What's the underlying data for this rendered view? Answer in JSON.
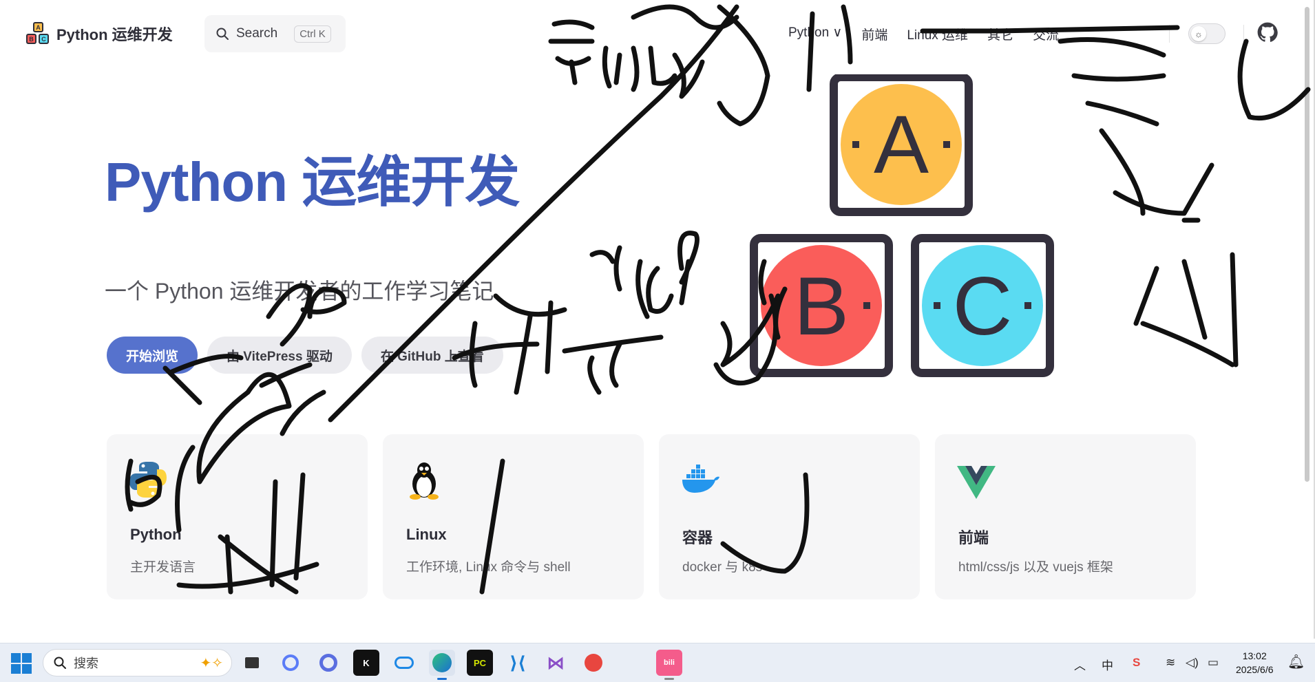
{
  "nav": {
    "site_title": "Python 运维开发",
    "search_placeholder": "Search",
    "search_shortcut": "Ctrl K",
    "links": [
      "Python ∨",
      "前端",
      "Linux 运维",
      "其它",
      "交流"
    ]
  },
  "hero": {
    "name": "Python 运维开发",
    "tagline": "一个 Python 运维开发者的工作学习笔记",
    "actions": [
      "开始浏览",
      "由 VitePress 驱动",
      "在 GitHub 上查看"
    ],
    "image_letters": [
      "A",
      "B",
      "C"
    ]
  },
  "features": [
    {
      "title": "Python",
      "details": "主开发语言",
      "icon": "python-logo-icon"
    },
    {
      "title": "Linux",
      "details": "工作环境, Linux 命令与 shell",
      "icon": "tux-penguin-icon"
    },
    {
      "title": "容器",
      "details": "docker 与 k8s",
      "icon": "docker-whale-icon"
    },
    {
      "title": "前端",
      "details": "html/css/js 以及 vuejs 框架",
      "icon": "vue-logo-icon"
    }
  ],
  "taskbar": {
    "search_placeholder": "搜索",
    "ime": "中",
    "time": "13:02",
    "date": "2025/6/6"
  },
  "colors": {
    "brand": "#5672cd",
    "hero_name": "#3f5bb8",
    "block_a": "#fdbf4d",
    "block_b": "#fa5d5a",
    "block_c": "#5adbf2"
  }
}
